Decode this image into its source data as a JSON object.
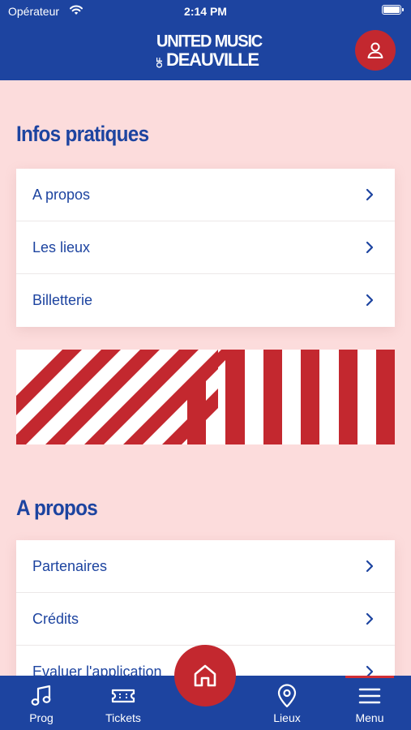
{
  "status_bar": {
    "carrier": "Opérateur",
    "time": "2:14 PM"
  },
  "header": {
    "logo_line1": "UNITED MUSIC",
    "logo_of": "OF",
    "logo_line2": "DEAUVILLE",
    "avatar_icon": "user-icon"
  },
  "sections": [
    {
      "title": "Infos pratiques",
      "items": [
        "A propos",
        "Les lieux",
        "Billetterie"
      ]
    },
    {
      "title": "A propos",
      "items": [
        "Partenaires",
        "Crédits",
        "Evaluer l'application"
      ]
    }
  ],
  "tabs": [
    {
      "label": "Prog",
      "icon": "music-note-icon"
    },
    {
      "label": "Tickets",
      "icon": "ticket-icon"
    },
    {
      "label": "Lieux",
      "icon": "map-pin-icon"
    },
    {
      "label": "Menu",
      "icon": "hamburger-icon"
    }
  ],
  "home_icon": "home-icon",
  "colors": {
    "primary": "#1d44a0",
    "accent": "#c3282f",
    "background": "#fcdcdc"
  }
}
